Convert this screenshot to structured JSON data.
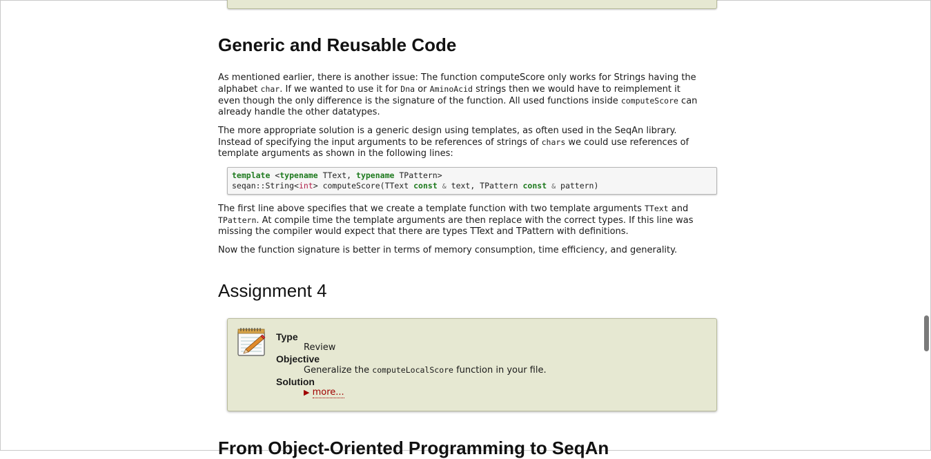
{
  "section1": {
    "heading": "Generic and Reusable Code",
    "p1": [
      "As mentioned earlier, there is another issue: The function computeScore only works for Strings having the",
      "alphabet ",
      "char",
      ". If we wanted to use it for ",
      "Dna",
      " or ",
      "AminoAcid",
      " strings then we would have to reimplement it",
      "even though the only difference is the signature of the function. All used functions inside ",
      "computeScore",
      " can",
      "already handle the other datatypes."
    ],
    "p2": [
      "The more appropriate solution is a generic design using templates, as often used in the SeqAn library.",
      "Instead of specifying the input arguments to be references of strings of ",
      "chars",
      " we could use references of",
      "template arguments as shown in the following lines:"
    ],
    "code_line1": [
      "template",
      " <",
      "typename",
      " TText, ",
      "typename",
      " TPattern>"
    ],
    "code_line2": [
      "seqan::String<",
      "int",
      "> computeScore(TText ",
      "const",
      " ",
      "&",
      " text, TPattern ",
      "const",
      " ",
      "&",
      " pattern)"
    ],
    "p3": [
      "The first line above specifies that we create a template function with two template arguments ",
      "TText",
      " and",
      "TPattern",
      ". At compile time the template arguments are then replace with the correct types. If this line was",
      "missing the compiler would expect that there are types TText and TPattern with definitions."
    ],
    "p4": "Now the function signature is better in terms of memory consumption, time efficiency, and generality."
  },
  "assignment": {
    "heading": "Assignment 4",
    "type_label": "Type",
    "type_value": "Review",
    "objective_label": "Objective",
    "objective_pre": "Generalize the ",
    "objective_code": "computeLocalScore",
    "objective_post": " function in your file.",
    "solution_label": "Solution",
    "more_arrow": "▶",
    "more_label": "more..."
  },
  "section2": {
    "heading": "From Object-Oriented Programming to SeqAn"
  }
}
